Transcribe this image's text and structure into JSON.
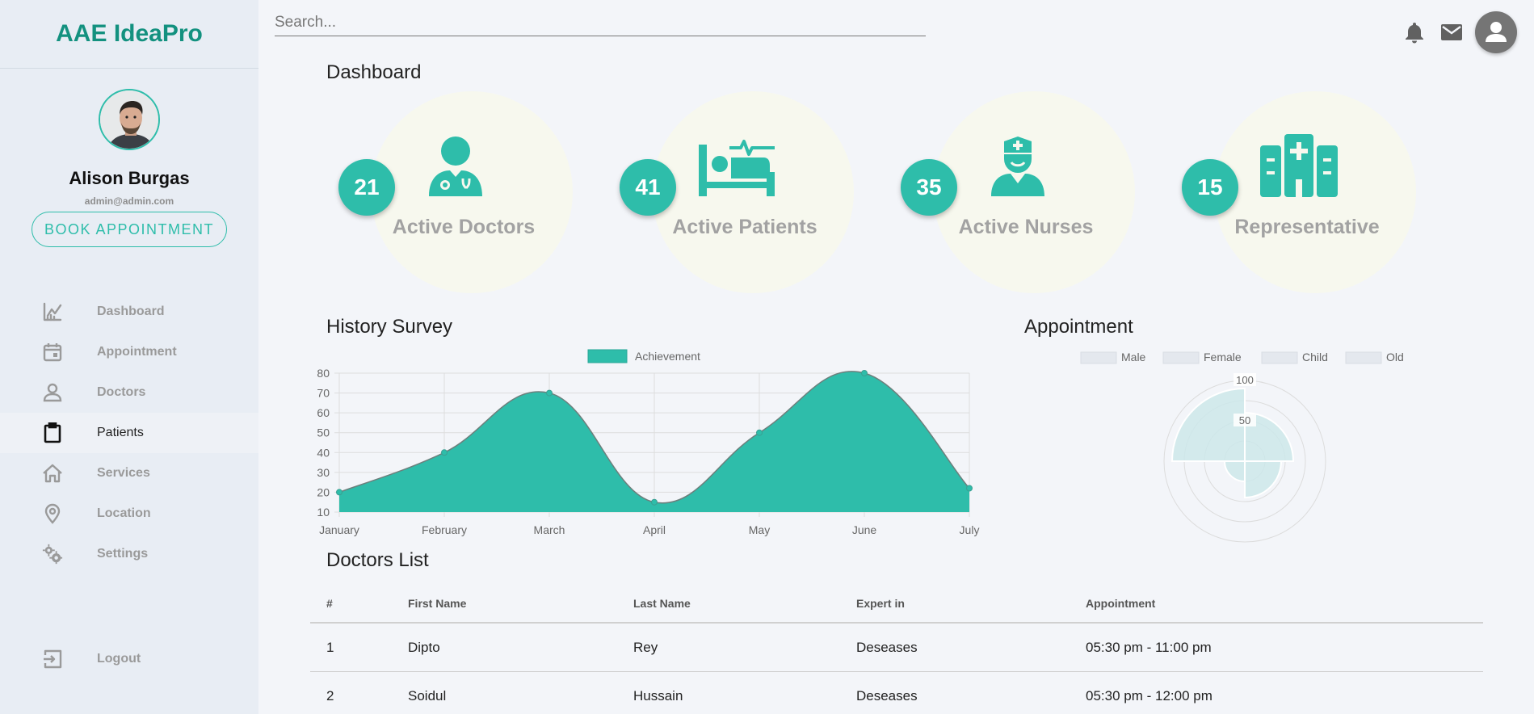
{
  "brand": "AAE IdeaPro",
  "search": {
    "placeholder": "Search..."
  },
  "user": {
    "name": "Alison Burgas",
    "email": "admin@admin.com",
    "book_label": "BOOK APPOINTMENT"
  },
  "nav": {
    "items": [
      {
        "label": "Dashboard",
        "icon": "chart-line-icon"
      },
      {
        "label": "Appointment",
        "icon": "calendar-icon"
      },
      {
        "label": "Doctors",
        "icon": "person-icon"
      },
      {
        "label": "Patients",
        "icon": "clipboard-icon",
        "active": true
      },
      {
        "label": "Services",
        "icon": "home-icon"
      },
      {
        "label": "Location",
        "icon": "location-pin-icon"
      },
      {
        "label": "Settings",
        "icon": "gears-icon"
      }
    ],
    "logout": "Logout"
  },
  "page_title": "Dashboard",
  "stats": [
    {
      "count": "21",
      "label": "Active Doctors",
      "icon": "doctor-icon"
    },
    {
      "count": "41",
      "label": "Active Patients",
      "icon": "hospital-bed-icon"
    },
    {
      "count": "35",
      "label": "Active Nurses",
      "icon": "nurse-icon"
    },
    {
      "count": "15",
      "label": "Representative",
      "icon": "hospital-building-icon"
    }
  ],
  "history": {
    "title": "History Survey"
  },
  "appointment": {
    "title": "Appointment"
  },
  "colors": {
    "accent": "#2ebdaa",
    "brand": "#13917f",
    "polar_fill": "#cce8ea"
  },
  "chart_data": [
    {
      "type": "area",
      "title": "History Survey",
      "categories": [
        "January",
        "February",
        "March",
        "April",
        "May",
        "June",
        "July"
      ],
      "series": [
        {
          "name": "Achievement",
          "values": [
            20,
            40,
            70,
            15,
            50,
            80,
            22
          ]
        }
      ],
      "ylim": [
        10,
        80
      ],
      "yticks": [
        10,
        20,
        30,
        40,
        50,
        60,
        70,
        80
      ],
      "grid": true,
      "legend": "top-center"
    },
    {
      "type": "polar-area",
      "title": "Appointment",
      "categories": [
        "Male",
        "Female",
        "Child",
        "Old"
      ],
      "values": [
        60,
        45,
        25,
        90
      ],
      "rticks": [
        50,
        100
      ],
      "legend": "top-center"
    }
  ],
  "doctors_list": {
    "title": "Doctors List",
    "columns": [
      "#",
      "First Name",
      "Last Name",
      "Expert in",
      "Appointment"
    ],
    "rows": [
      [
        "1",
        "Dipto",
        "Rey",
        "Deseases",
        "05:30 pm - 11:00 pm"
      ],
      [
        "2",
        "Soidul",
        "Hussain",
        "Deseases",
        "05:30 pm - 12:00 pm"
      ]
    ]
  }
}
